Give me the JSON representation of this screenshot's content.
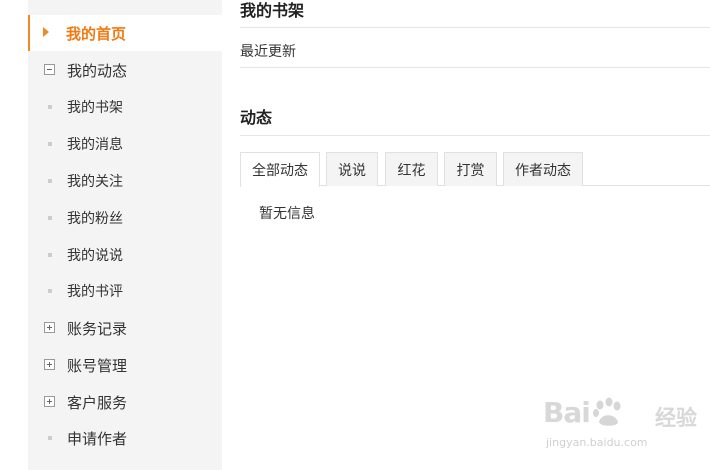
{
  "sidebar": {
    "home": "我的首页",
    "dynamics_group": "我的动态",
    "sub_items": [
      "我的书架",
      "我的消息",
      "我的关注",
      "我的粉丝",
      "我的说说",
      "我的书评"
    ],
    "account_records": "账务记录",
    "account_manage": "账号管理",
    "customer_service": "客户服务",
    "apply_author": "申请作者"
  },
  "main": {
    "bookshelf_title": "我的书架",
    "recent_updates": "最近更新",
    "dynamics_title": "动态",
    "tabs": [
      "全部动态",
      "说说",
      "红花",
      "打赏",
      "作者动态"
    ],
    "empty_text": "暂无信息"
  },
  "watermark": {
    "logo": "Bai",
    "logo_suffix": "经验",
    "url": "jingyan.baidu.com"
  },
  "colors": {
    "accent": "#f08a24",
    "sidebar_bg": "#f4f4f4"
  }
}
